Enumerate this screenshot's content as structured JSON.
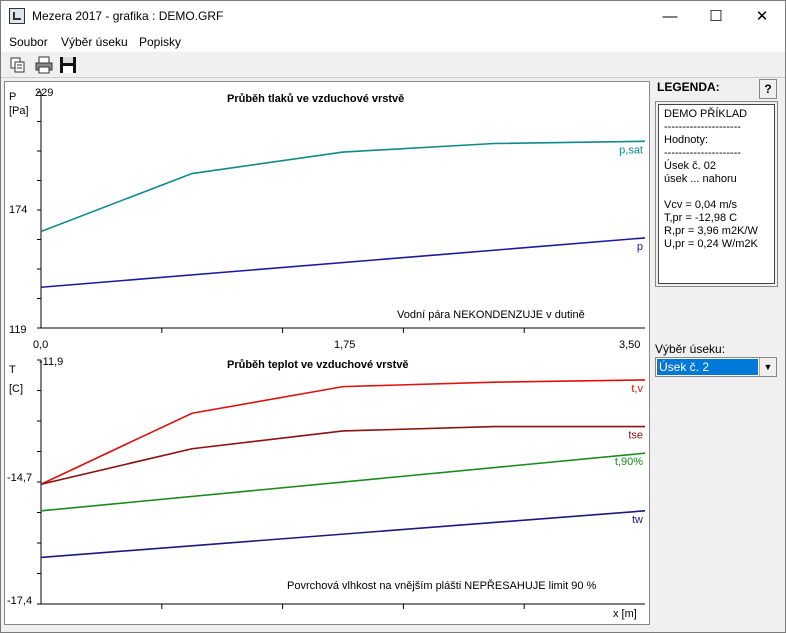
{
  "window": {
    "title": "Mezera 2017 - grafika : DEMO.GRF",
    "minimize": "—",
    "maximize": "☐",
    "close": "✕"
  },
  "menu": [
    "Soubor",
    "Výběr úseku",
    "Popisky"
  ],
  "toolbar": {
    "icons": [
      "copy-icon",
      "print-icon",
      "save-icon"
    ]
  },
  "legend": {
    "title": "LEGENDA:",
    "help": "?",
    "lines": [
      "DEMO PŘÍKLAD",
      "---------------------",
      "Hodnoty:",
      "---------------------",
      "Úsek č. 02",
      "úsek ...  nahoru",
      "",
      "Vcv = 0,04 m/s",
      "T,pr = -12,98 C",
      "R,pr = 3,96 m2K/W",
      "U,pr = 0,24 W/m2K"
    ]
  },
  "segment_select": {
    "label": "Výběr úseku:",
    "value": "Úsek č. 2"
  },
  "colors": {
    "teal": "#0f8a8a",
    "blue": "#1a1aa0",
    "red": "#e01010",
    "darkred": "#8b1010",
    "green": "#1a8a1a",
    "navy": "#1a1a80"
  },
  "chart_data": [
    {
      "type": "line",
      "title": "Průběh tlaků ve vzduchové vrstvě",
      "ylabel": "P",
      "yunit": "[Pa]",
      "ylim": [
        119,
        229
      ],
      "yticks": [
        "229",
        "174",
        "119"
      ],
      "xlim": [
        0,
        3.5
      ],
      "xticks": [
        "0,0",
        "1,75",
        "3,50"
      ],
      "annotation": "Vodní pára NEKONDENZUJE v dutině",
      "series": [
        {
          "name": "p,sat",
          "color": "#0f8a8a",
          "x": [
            0,
            0.875,
            1.75,
            2.625,
            3.5
          ],
          "y": [
            164,
            191,
            201,
            205,
            206
          ]
        },
        {
          "name": "p",
          "color": "#1a1aa0",
          "x": [
            0,
            3.5
          ],
          "y": [
            138,
            161
          ]
        }
      ]
    },
    {
      "type": "line",
      "title": "Průběh teplot ve vzduchové vrstvě",
      "ylabel": "T",
      "yunit": "[C]",
      "xlabel": "x [m]",
      "ylim": [
        -17.4,
        -11.9
      ],
      "yticks": [
        "-11,9",
        "-14,7",
        "-17,4"
      ],
      "xlim": [
        0,
        3.5
      ],
      "annotation": "Povrchová vlhkost na vnějším plášti NEPŘESAHUJE limit 90 %",
      "series": [
        {
          "name": "t,v",
          "color": "#e01010",
          "x": [
            0,
            0.875,
            1.75,
            2.625,
            3.5
          ],
          "y": [
            -14.7,
            -13.1,
            -12.5,
            -12.4,
            -12.35
          ]
        },
        {
          "name": "tse",
          "color": "#8b1010",
          "x": [
            0,
            0.875,
            1.75,
            2.625,
            3.5
          ],
          "y": [
            -14.7,
            -13.9,
            -13.5,
            -13.4,
            -13.4
          ]
        },
        {
          "name": "t,90%",
          "color": "#1a8a1a",
          "x": [
            0,
            3.5
          ],
          "y": [
            -15.3,
            -14.0
          ]
        },
        {
          "name": "tw",
          "color": "#1a1a80",
          "x": [
            0,
            3.5
          ],
          "y": [
            -16.35,
            -15.3
          ]
        }
      ]
    }
  ]
}
